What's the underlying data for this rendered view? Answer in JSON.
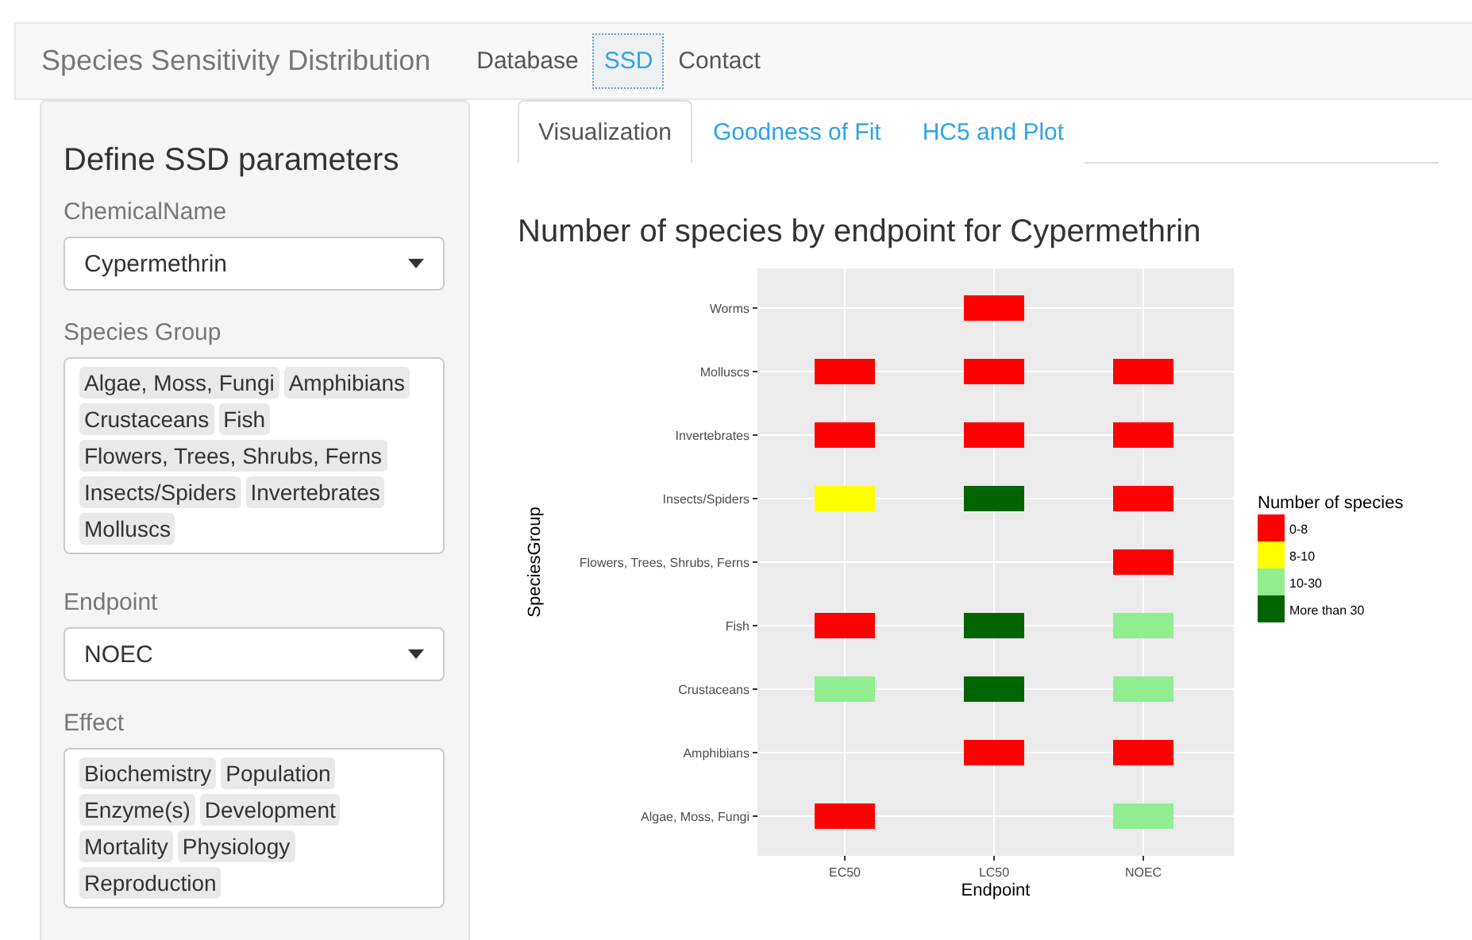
{
  "navbar": {
    "brand": "Species Sensitivity Distribution",
    "items": [
      {
        "label": "Database",
        "selected": false
      },
      {
        "label": "SSD",
        "selected": true
      },
      {
        "label": "Contact",
        "selected": false
      }
    ]
  },
  "sidebar": {
    "title": "Define SSD parameters",
    "fields": [
      {
        "kind": "select",
        "label": "ChemicalName",
        "value": "Cypermethrin"
      },
      {
        "kind": "multi",
        "label": "Species Group",
        "tags": [
          "Algae, Moss, Fungi",
          "Amphibians",
          "Crustaceans",
          "Fish",
          "Flowers, Trees, Shrubs, Ferns",
          "Insects/Spiders",
          "Invertebrates",
          "Molluscs"
        ]
      },
      {
        "kind": "select",
        "label": "Endpoint",
        "value": "NOEC"
      },
      {
        "kind": "multi",
        "label": "Effect",
        "tags": [
          "Biochemistry",
          "Population",
          "Enzyme(s)",
          "Development",
          "Mortality",
          "Physiology",
          "Reproduction"
        ]
      }
    ]
  },
  "tabs": [
    {
      "label": "Visualization",
      "selected": true
    },
    {
      "label": "Goodness of Fit",
      "selected": false
    },
    {
      "label": "HC5 and Plot",
      "selected": false
    }
  ],
  "plot": {
    "title": "Number of species by endpoint for Cypermethrin",
    "xlabel": "Endpoint",
    "ylabel": "SpeciesGroup",
    "x_categories": [
      "EC50",
      "LC50",
      "NOEC"
    ],
    "legend": {
      "title": "Number of species",
      "classes": [
        {
          "name": "0-8",
          "color": "#ff0000"
        },
        {
          "name": "8-10",
          "color": "#ffff00"
        },
        {
          "name": "10-30",
          "color": "#90ee90"
        },
        {
          "name": "More than 30",
          "color": "#006400"
        }
      ]
    },
    "rows": [
      {
        "group": "Worms",
        "cells": [
          null,
          {
            "color": "#ff0000"
          },
          null
        ]
      },
      {
        "group": "Molluscs",
        "cells": [
          {
            "color": "#ff0000"
          },
          {
            "color": "#ff0000"
          },
          {
            "color": "#ff0000"
          }
        ]
      },
      {
        "group": "Invertebrates",
        "cells": [
          {
            "color": "#ff0000"
          },
          {
            "color": "#ff0000"
          },
          {
            "color": "#ff0000"
          }
        ]
      },
      {
        "group": "Insects/Spiders",
        "cells": [
          {
            "color": "#ffff00"
          },
          {
            "color": "#006400"
          },
          {
            "color": "#ff0000"
          }
        ]
      },
      {
        "group": "Flowers, Trees, Shrubs, Ferns",
        "cells": [
          null,
          null,
          {
            "color": "#ff0000"
          }
        ]
      },
      {
        "group": "Fish",
        "cells": [
          {
            "color": "#ff0000"
          },
          {
            "color": "#006400"
          },
          {
            "color": "#90ee90"
          }
        ]
      },
      {
        "group": "Crustaceans",
        "cells": [
          {
            "color": "#90ee90"
          },
          {
            "color": "#006400"
          },
          {
            "color": "#90ee90"
          }
        ]
      },
      {
        "group": "Amphibians",
        "cells": [
          null,
          {
            "color": "#ff0000"
          },
          {
            "color": "#ff0000"
          }
        ]
      },
      {
        "group": "Algae, Moss, Fungi",
        "cells": [
          {
            "color": "#ff0000"
          },
          null,
          {
            "color": "#90ee90"
          }
        ]
      }
    ]
  }
}
